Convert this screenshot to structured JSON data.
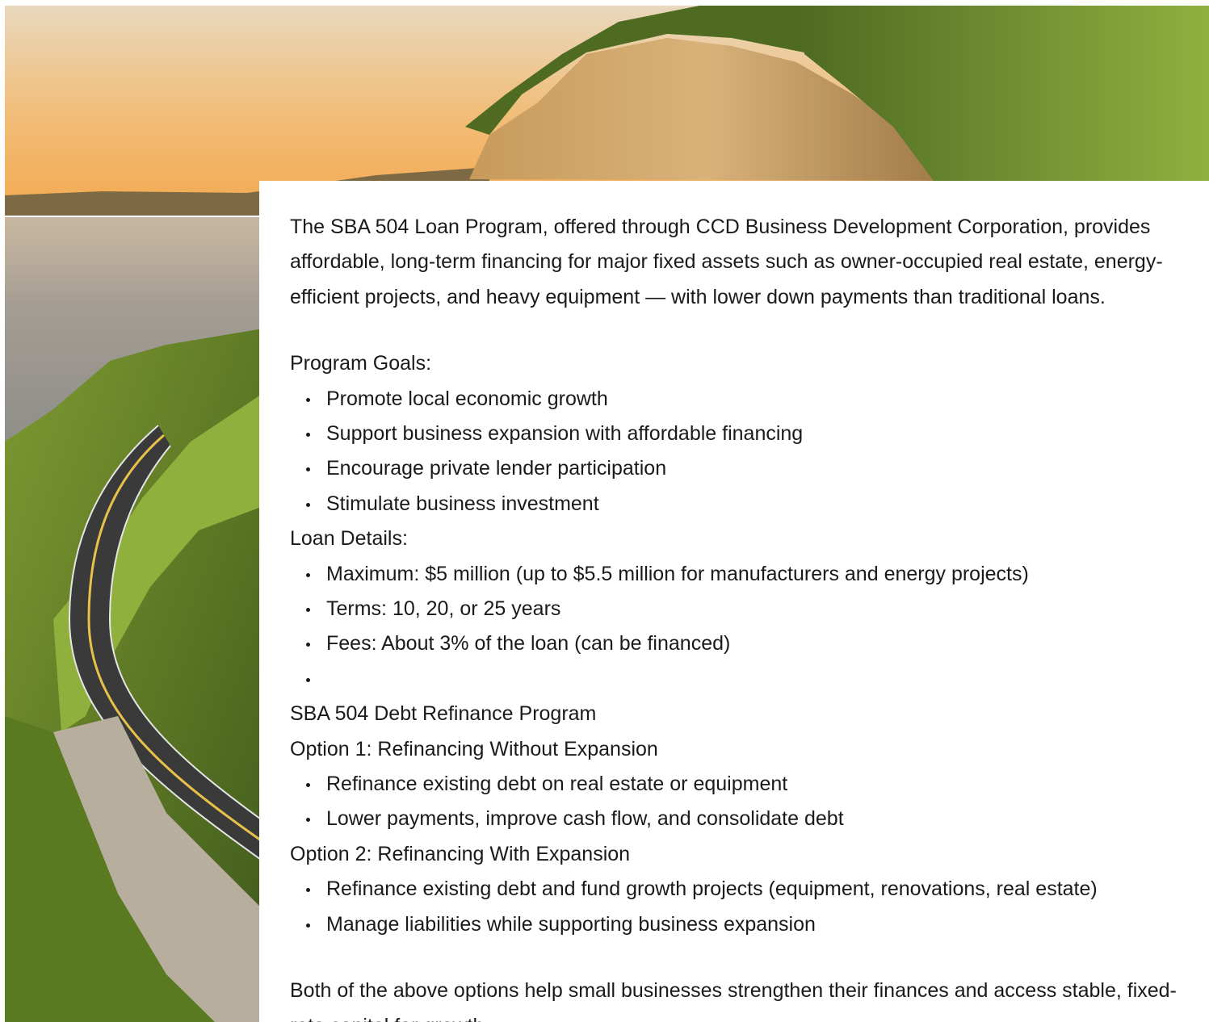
{
  "intro": "The SBA 504 Loan Program, offered through CCD Business Development Corporation, provides affordable, long-term financing for major fixed assets such as owner-occupied real estate, energy-efficient projects, and heavy equipment — with lower down payments than traditional loans.",
  "program_goals": {
    "label": "Program Goals:",
    "items": [
      "Promote local economic growth",
      "Support business expansion with affordable financing",
      "Encourage private lender participation",
      "Stimulate business investment"
    ]
  },
  "loan_details": {
    "label": "Loan Details:",
    "items": [
      "Maximum: $5 million (up to $5.5 million for manufacturers and energy projects)",
      "Terms: 10, 20, or 25 years",
      "Fees: About 3% of the loan (can be financed)",
      ""
    ]
  },
  "refinance": {
    "title": "SBA 504 Debt Refinance Program",
    "option1": {
      "label": "Option 1: Refinancing Without Expansion",
      "items": [
        "Refinance existing debt on real estate or equipment",
        "Lower payments, improve cash flow, and consolidate debt"
      ]
    },
    "option2": {
      "label": "Option 2: Refinancing With Expansion",
      "items": [
        "Refinance existing debt and fund growth projects (equipment, renovations, real estate)",
        "Manage liabilities while supporting business expansion"
      ]
    }
  },
  "closing": "Both of the above options help small businesses strengthen their finances and access stable, fixed-rate capital for growth.",
  "colors": {
    "text": "#1a1a1a",
    "background": "#ffffff",
    "sky": "#f2b768",
    "forest": "#6f8a2c",
    "river": "#a69e91"
  }
}
